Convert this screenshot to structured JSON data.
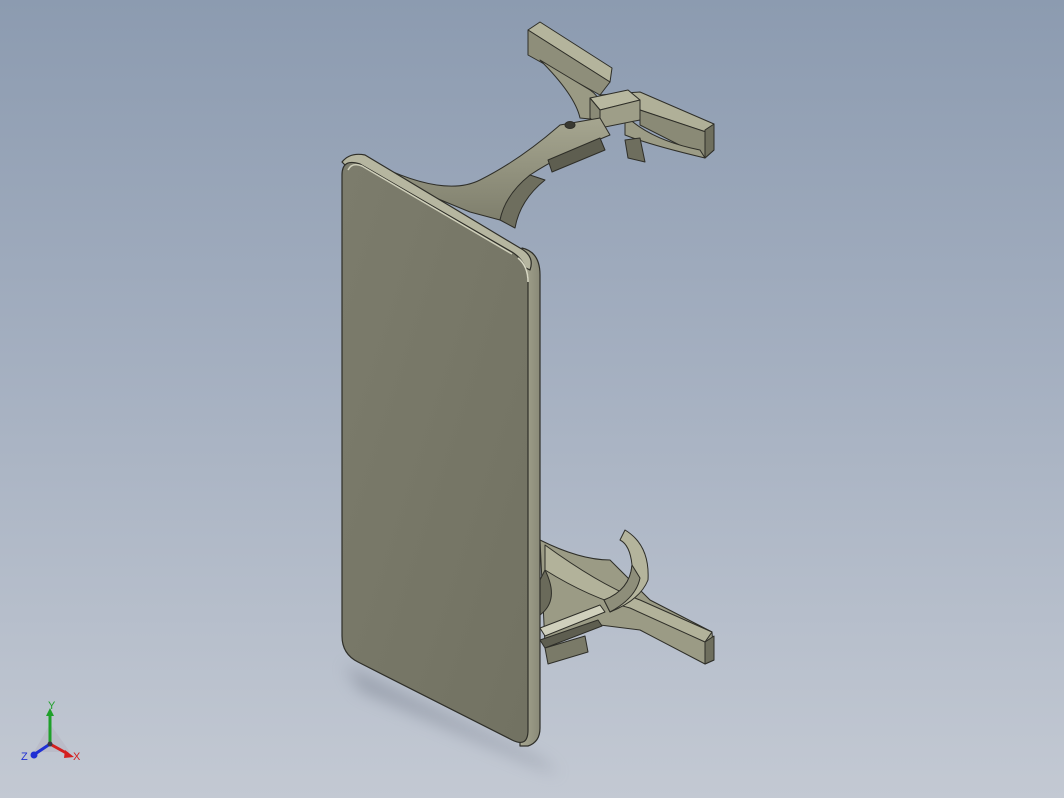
{
  "viewport": {
    "background_top": "#8c9bb0",
    "background_bottom": "#c3c9d3",
    "model_color": "#7a7a6a"
  },
  "triad": {
    "x_label": "X",
    "y_label": "Y",
    "z_label": "Z",
    "x_color": "#d41f1f",
    "y_color": "#1fa02a",
    "z_color": "#1f2fd4"
  }
}
